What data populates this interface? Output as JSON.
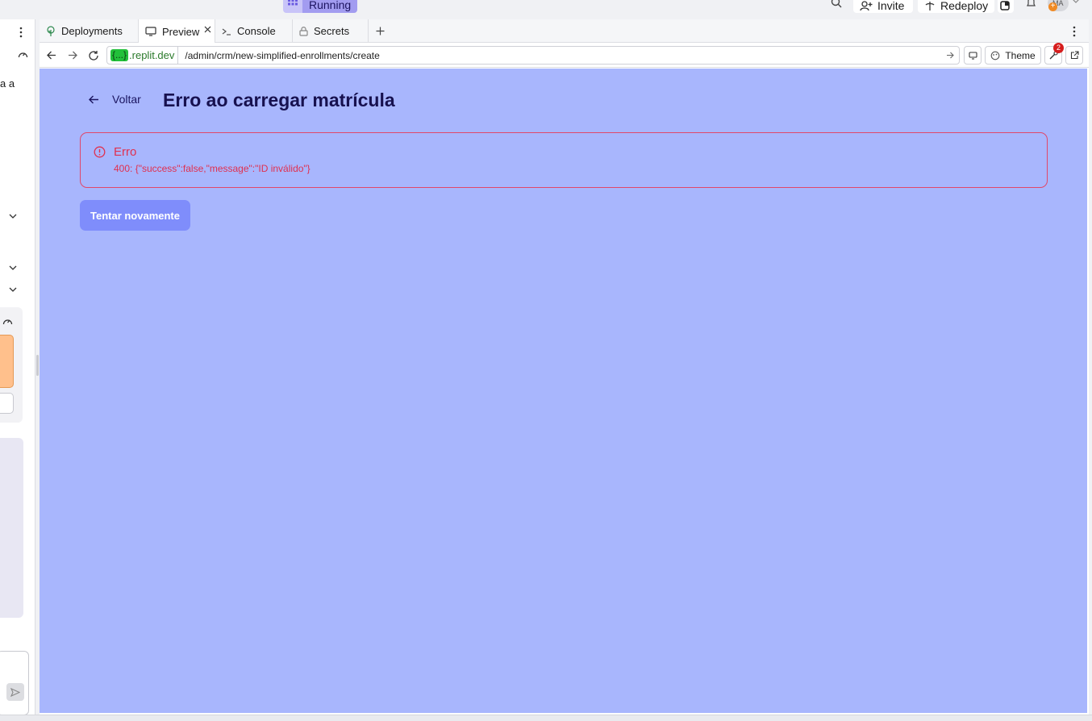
{
  "topbar": {
    "run_status": "Running",
    "invite_label": "Invite",
    "redeploy_label": "Redeploy",
    "avatar_initials": "MA"
  },
  "left_panel": {
    "truncated_text": "a a"
  },
  "tabs": [
    {
      "label": "Deployments",
      "icon": "deployments-icon"
    },
    {
      "label": "Preview",
      "icon": "monitor-icon",
      "active": true
    },
    {
      "label": "Console",
      "icon": "terminal-icon"
    },
    {
      "label": "Secrets",
      "icon": "lock-icon"
    }
  ],
  "urlbar": {
    "domain_prefix": "{...}",
    "domain": ".replit.dev",
    "path": "/admin/crm/new-simplified-enrollments/create",
    "theme_label": "Theme",
    "notification_count": "2"
  },
  "page": {
    "back_label": "Voltar",
    "title": "Erro ao carregar matrícula",
    "alert_title": "Erro",
    "alert_message": "400: {\"success\":false,\"message\":\"ID inválido\"}",
    "retry_label": "Tentar novamente"
  },
  "colors": {
    "preview_bg": "#a8b6fd",
    "error": "#e0304f",
    "primary_button": "#7f8dfb",
    "title": "#17114f"
  }
}
